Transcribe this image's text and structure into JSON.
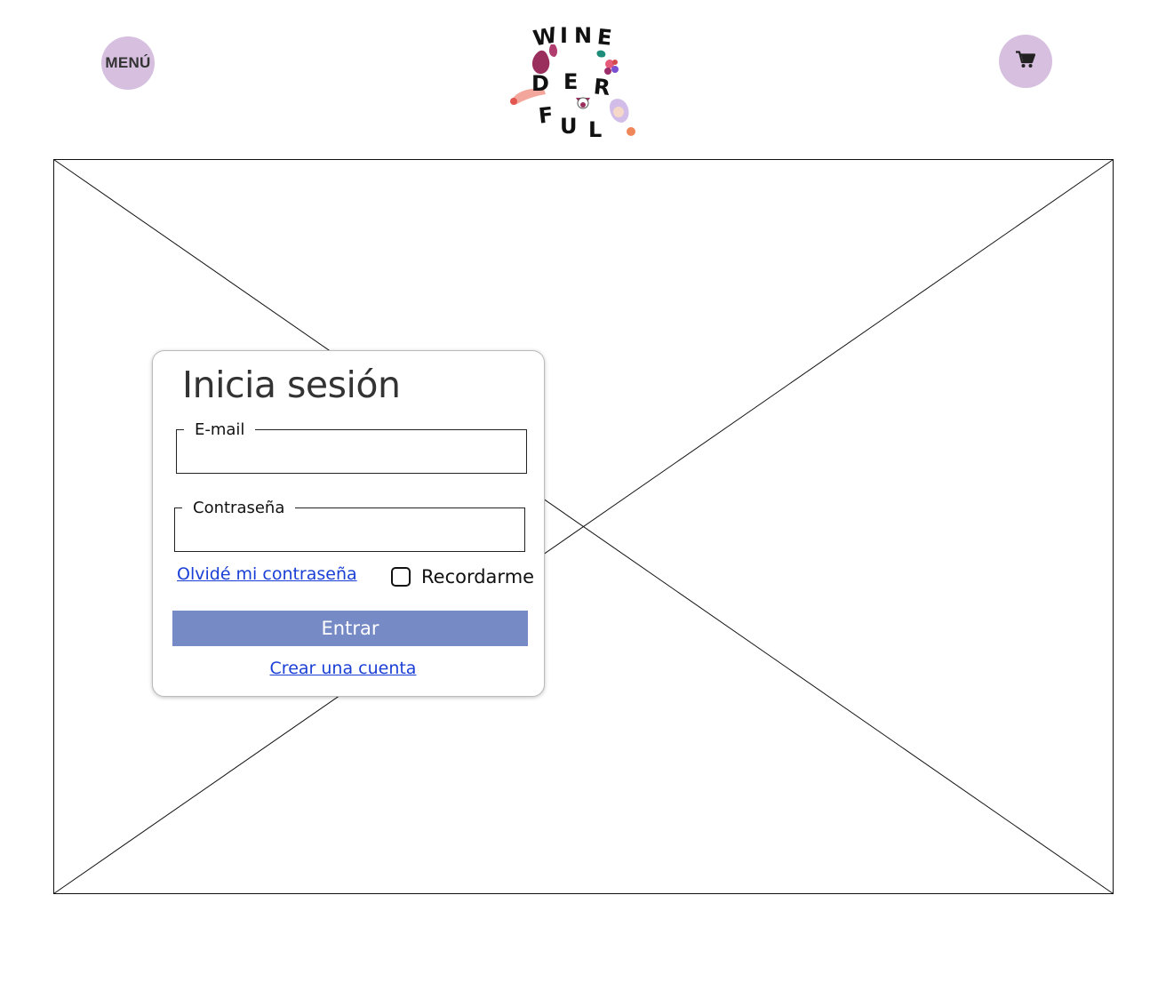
{
  "header": {
    "menu_label": "MENÚ",
    "cart_icon": "cart-icon",
    "logo_lines": [
      "WINE",
      "DER",
      "FUL"
    ],
    "accent_color": "#d6bfdf"
  },
  "hero": {
    "placeholder_icon": "image-placeholder"
  },
  "login": {
    "title": "Inicia sesión",
    "email_label": "E-mail",
    "email_value": "",
    "password_label": "Contraseña",
    "password_value": "",
    "forgot_label": "Olvidé mi contraseña",
    "remember_label": "Recordarme",
    "remember_checked": false,
    "submit_label": "Entrar",
    "submit_color": "#768bc6",
    "create_account_label": "Crear una cuenta",
    "link_color": "#1a3fd6"
  }
}
